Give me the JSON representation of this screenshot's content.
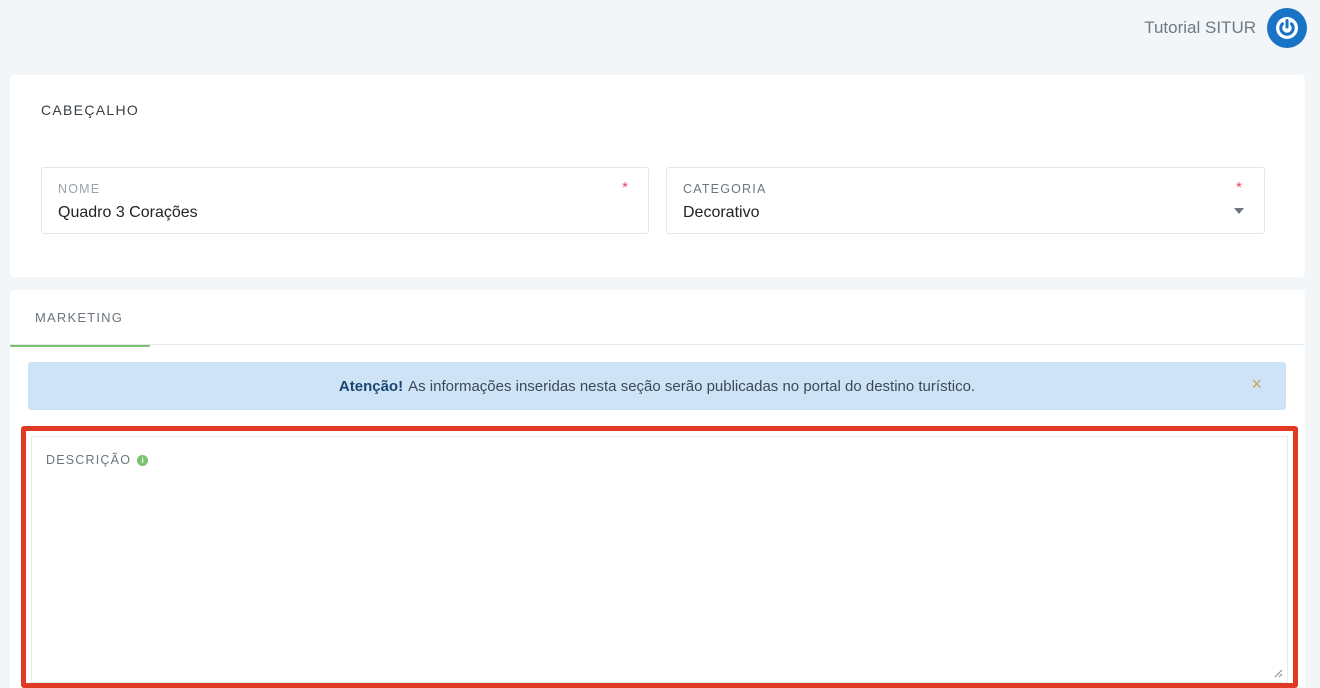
{
  "header": {
    "user_name": "Tutorial SITUR",
    "power_icon": "power-icon"
  },
  "cabecalho": {
    "title": "CABEÇALHO",
    "nome": {
      "label": "NOME",
      "value": "Quadro 3 Corações",
      "required_mark": "*"
    },
    "categoria": {
      "label": "CATEGORIA",
      "value": "Decorativo",
      "required_mark": "*"
    }
  },
  "marketing": {
    "tab_label": "MARKETING",
    "alert": {
      "strong": "Atenção!",
      "text": "As informações inseridas nesta seção serão publicadas no portal do destino turístico.",
      "close": "×"
    },
    "descricao": {
      "label": "DESCRIÇÃO",
      "info_icon": "i",
      "value": ""
    }
  },
  "colors": {
    "primary": "#1a73c5",
    "accent_green": "#7cc36d",
    "required_red": "#e8455d",
    "highlight_red": "#e03a24",
    "alert_bg": "#cfe3f6"
  }
}
